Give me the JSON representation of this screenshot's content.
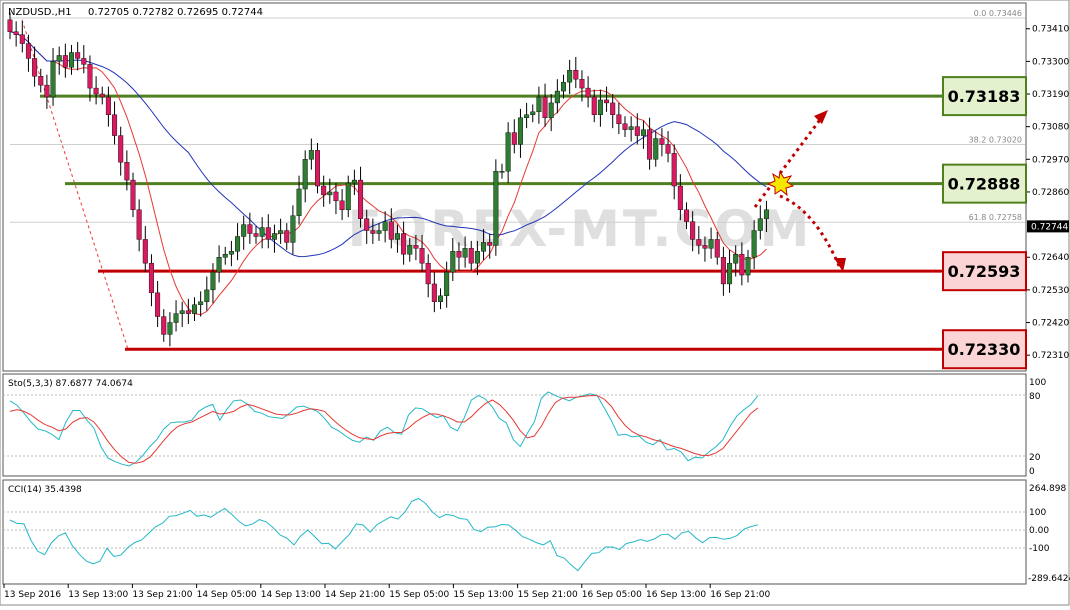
{
  "header": {
    "symbol": "NZDUSD.,H1",
    "ohlc": "0.72705 0.72782 0.72695 0.72744"
  },
  "main_axis": {
    "ticks": [
      "0.73410",
      "0.73300",
      "0.73190",
      "0.73080",
      "0.72970",
      "0.72860",
      "0.72640",
      "0.72530",
      "0.72420",
      "0.72310"
    ],
    "current_price": "0.72744",
    "ylim": [
      0.7226,
      0.7349
    ]
  },
  "levels": [
    {
      "label": "0.73183",
      "value": 0.73183,
      "kind": "resistance"
    },
    {
      "label": "0.72888",
      "value": 0.72888,
      "kind": "resistance"
    },
    {
      "label": "0.72593",
      "value": 0.72593,
      "kind": "support"
    },
    {
      "label": "0.72330",
      "value": 0.7233,
      "kind": "support"
    }
  ],
  "fibonacci": [
    {
      "label": "0.0 0.73446",
      "value": 0.73446
    },
    {
      "label": "38.2 0.73020",
      "value": 0.7302
    },
    {
      "label": "61.8 0.72758",
      "value": 0.72758
    }
  ],
  "watermark": "FOREX-MT.COM",
  "stochastic": {
    "label": "Sto(5,3,3) 87.6877 74.0674",
    "ticks": [
      "100",
      "80",
      "20",
      "0"
    ],
    "ylim": [
      0,
      100
    ]
  },
  "cci": {
    "label": "CCI(14) 35.4398",
    "ticks": [
      "264.898",
      "100",
      "0.00",
      "-100",
      "-289.6424"
    ],
    "ylim": [
      -289.6424,
      264.898
    ]
  },
  "x_axis": {
    "labels": [
      "13 Sep 2016",
      "13 Sep 13:00",
      "13 Sep 21:00",
      "14 Sep 05:00",
      "14 Sep 13:00",
      "14 Sep 21:00",
      "15 Sep 05:00",
      "15 Sep 13:00",
      "15 Sep 21:00",
      "16 Sep 05:00",
      "16 Sep 13:00",
      "16 Sep 21:00"
    ]
  },
  "colors": {
    "bull": "#2e7d32",
    "bear": "#d81b60",
    "resistance_line": "#4f7f1f",
    "resistance_fill": "#e3f1cf",
    "support_line": "#c00000",
    "support_fill": "#fbd5d5",
    "ma_fast": "#e53935",
    "ma_slow": "#2233bb",
    "stoch_main": "#22b8c8",
    "stoch_signal": "#e53935",
    "cci_line": "#22b8c8"
  },
  "chart_data": [
    {
      "type": "candlestick",
      "title": "NZDUSD.,H1",
      "ylim": [
        0.7226,
        0.7349
      ],
      "close": [
        0.734,
        0.7339,
        0.7336,
        0.7331,
        0.7325,
        0.7322,
        0.7318,
        0.733,
        0.7332,
        0.7328,
        0.7333,
        0.7331,
        0.7329,
        0.7321,
        0.7319,
        0.7318,
        0.7312,
        0.7305,
        0.7296,
        0.729,
        0.728,
        0.727,
        0.7262,
        0.7252,
        0.7244,
        0.7238,
        0.7242,
        0.7245,
        0.7246,
        0.7245,
        0.7248,
        0.7249,
        0.7253,
        0.7259,
        0.7264,
        0.7265,
        0.7266,
        0.7271,
        0.7275,
        0.7272,
        0.7271,
        0.7274,
        0.727,
        0.7272,
        0.7273,
        0.7269,
        0.7278,
        0.7287,
        0.7297,
        0.73,
        0.7288,
        0.7285,
        0.7286,
        0.7283,
        0.728,
        0.7289,
        0.729,
        0.7277,
        0.7273,
        0.7272,
        0.7273,
        0.7276,
        0.727,
        0.7272,
        0.7265,
        0.7268,
        0.7267,
        0.7262,
        0.7255,
        0.7249,
        0.7251,
        0.7259,
        0.7266,
        0.7264,
        0.7267,
        0.7262,
        0.7266,
        0.7269,
        0.7268,
        0.7293,
        0.7293,
        0.7306,
        0.7302,
        0.7311,
        0.7312,
        0.7313,
        0.7318,
        0.7311,
        0.7316,
        0.732,
        0.7323,
        0.7327,
        0.7324,
        0.7321,
        0.7318,
        0.7312,
        0.7317,
        0.7316,
        0.7312,
        0.7309,
        0.7307,
        0.7308,
        0.7305,
        0.7307,
        0.7297,
        0.7304,
        0.7302,
        0.7299,
        0.7288,
        0.728,
        0.7276,
        0.727,
        0.7268,
        0.7267,
        0.727,
        0.7264,
        0.7255,
        0.7262,
        0.7265,
        0.7258,
        0.7264,
        0.7273,
        0.7277,
        0.728
      ]
    },
    {
      "type": "line",
      "title": "Sto(5,3,3) 87.6877 74.0674",
      "series": [
        {
          "name": "main",
          "values": [
            82,
            77,
            68,
            58,
            50,
            48,
            44,
            38,
            58,
            71,
            71,
            60,
            51,
            30,
            17,
            13,
            10,
            8,
            12,
            20,
            30,
            38,
            50,
            57,
            58,
            58,
            60,
            70,
            75,
            78,
            60,
            72,
            82,
            83,
            78,
            70,
            68,
            64,
            63,
            62,
            68,
            75,
            76,
            73,
            70,
            62,
            52,
            48,
            42,
            37,
            35,
            41,
            37,
            48,
            52,
            46,
            44,
            66,
            74,
            73,
            68,
            63,
            65,
            52,
            48,
            63,
            83,
            88,
            84,
            75,
            62,
            57,
            38,
            30,
            45,
            58,
            85,
            92,
            88,
            85,
            82,
            86,
            88,
            90,
            88,
            74,
            60,
            43,
            44,
            41,
            42,
            35,
            32,
            38,
            26,
            28,
            24,
            14,
            18,
            17,
            24,
            30,
            38,
            53,
            65,
            72,
            78,
            88
          ]
        },
        {
          "name": "signal",
          "values": [
            70,
            72,
            70,
            66,
            60,
            55,
            52,
            48,
            50,
            58,
            62,
            63,
            58,
            48,
            36,
            26,
            18,
            12,
            11,
            13,
            18,
            27,
            37,
            46,
            53,
            56,
            58,
            62,
            66,
            70,
            67,
            68,
            70,
            75,
            78,
            76,
            73,
            70,
            67,
            66,
            66,
            68,
            71,
            73,
            72,
            70,
            62,
            55,
            49,
            44,
            40,
            39,
            38,
            42,
            45,
            46,
            46,
            51,
            58,
            63,
            67,
            67,
            65,
            62,
            58,
            58,
            64,
            72,
            79,
            83,
            78,
            70,
            60,
            48,
            40,
            42,
            53,
            68,
            80,
            85,
            86,
            86,
            87,
            88,
            88,
            84,
            76,
            64,
            54,
            47,
            43,
            41,
            38,
            36,
            33,
            30,
            28,
            25,
            22,
            20,
            20,
            23,
            28,
            38,
            48,
            58,
            68,
            74
          ]
        }
      ]
    },
    {
      "type": "line",
      "title": "CCI(14) 35.4398",
      "series": [
        {
          "name": "CCI",
          "values": [
            63,
            43,
            40,
            -53,
            -118,
            -138,
            -68,
            -29,
            -12,
            -85,
            -135,
            -174,
            -190,
            -175,
            -100,
            -148,
            -140,
            -98,
            -67,
            -53,
            -15,
            23,
            44,
            84,
            88,
            102,
            118,
            84,
            92,
            79,
            106,
            129,
            96,
            57,
            28,
            39,
            65,
            52,
            18,
            -24,
            -43,
            -81,
            -28,
            5,
            -33,
            -74,
            -72,
            -104,
            -61,
            -20,
            41,
            33,
            -8,
            37,
            59,
            81,
            68,
            108,
            170,
            187,
            158,
            109,
            76,
            95,
            88,
            71,
            67,
            7,
            -4,
            21,
            23,
            37,
            34,
            3,
            -33,
            -49,
            -68,
            -81,
            -57,
            -143,
            -157,
            -196,
            -230,
            -178,
            -130,
            -126,
            -93,
            -93,
            -108,
            -73,
            -64,
            -50,
            -61,
            -47,
            -23,
            -19,
            -48,
            -11,
            -3,
            -40,
            -68,
            -39,
            -38,
            -49,
            -43,
            -26,
            10,
            25,
            35
          ]
        }
      ]
    }
  ]
}
